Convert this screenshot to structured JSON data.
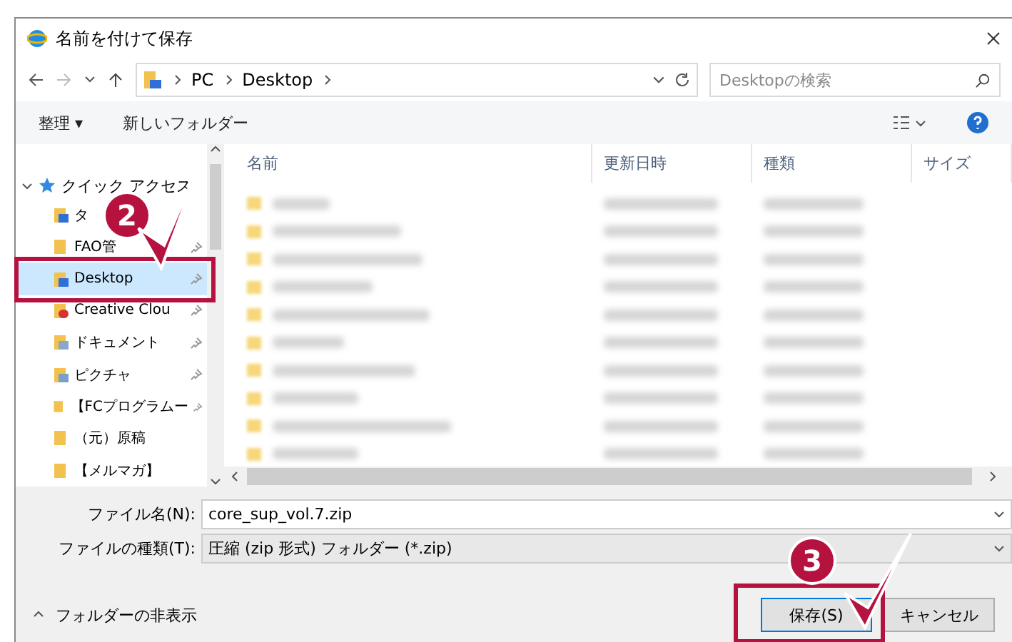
{
  "window": {
    "title": "名前を付けて保存"
  },
  "address": {
    "path": [
      "PC",
      "Desktop"
    ],
    "search_placeholder": "Desktopの検索"
  },
  "toolbar": {
    "organize": "整理 ▾",
    "new_folder": "新しいフォルダー"
  },
  "sidebar": {
    "group": "クイック アクセス",
    "expanded": true,
    "items": [
      {
        "label": "タ",
        "kind": "download",
        "pinned": false,
        "selected": false
      },
      {
        "label": "FAO管",
        "kind": "folder",
        "pinned": true,
        "selected": false
      },
      {
        "label": "Desktop",
        "kind": "desktop",
        "pinned": true,
        "selected": true
      },
      {
        "label": "Creative Clou",
        "kind": "cloud",
        "pinned": true,
        "selected": false
      },
      {
        "label": "ドキュメント",
        "kind": "document",
        "pinned": true,
        "selected": false
      },
      {
        "label": "ピクチャ",
        "kind": "picture",
        "pinned": true,
        "selected": false
      },
      {
        "label": "【FCプログラムー",
        "kind": "folder",
        "pinned": true,
        "selected": false
      },
      {
        "label": "（元）原稿",
        "kind": "folder",
        "pinned": false,
        "selected": false
      },
      {
        "label": "【メルマガ】",
        "kind": "folder",
        "pinned": false,
        "selected": false
      }
    ]
  },
  "table": {
    "columns": [
      "名前",
      "更新日時",
      "種類",
      "サイズ"
    ]
  },
  "form": {
    "filename_label": "ファイル名(N):",
    "filename": "core_sup_vol.7.zip",
    "type_label": "ファイルの種類(T):",
    "type": "圧縮 (zip 形式) フォルダー (*.zip)"
  },
  "footer": {
    "hide_folders": "フォルダーの非表示",
    "buttons": [
      "保存(S)",
      "キャンセル"
    ]
  },
  "annotations": [
    "2",
    "3"
  ]
}
